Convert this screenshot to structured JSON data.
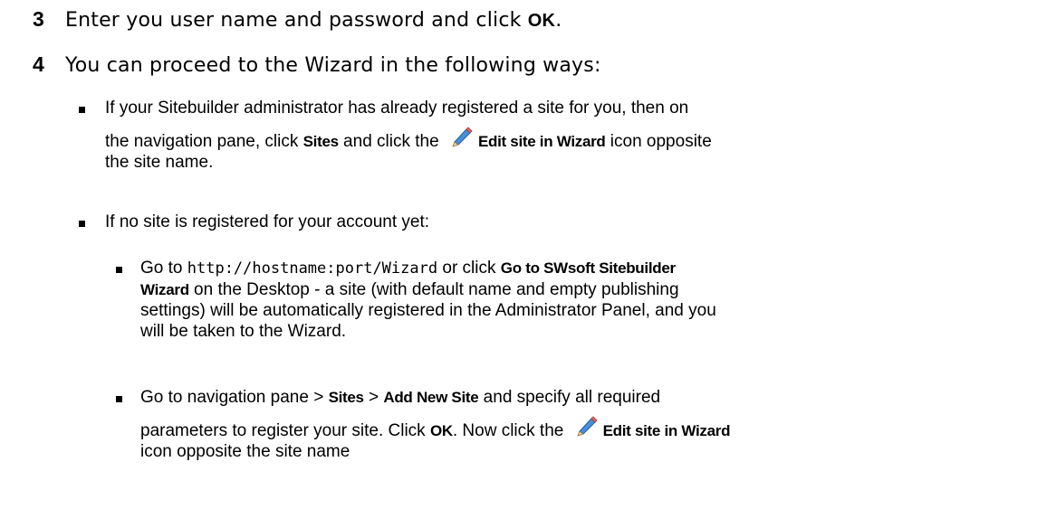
{
  "steps": [
    {
      "number": "3",
      "text_before": "Enter you user name and password and click ",
      "bold": "OK",
      "text_after": "."
    },
    {
      "number": "4",
      "text": "You can proceed to the Wizard in the following ways:"
    }
  ],
  "bullet1": {
    "line1": "If your Sitebuilder administrator has already registered a site for you, then on",
    "l2_a": "the navigation pane, click ",
    "l2_b_bold": "Sites",
    "l2_c": " and click the ",
    "l2_d_bold": "Edit site in Wizard",
    "l2_e": " icon opposite",
    "line3": "the site name."
  },
  "bullet2": {
    "text": "If no site is registered for your account yet:"
  },
  "sub1": {
    "l1_a": "Go to ",
    "l1_code": "http://hostname:port/Wizard",
    "l1_b": " or click ",
    "l1_bold": "Go to SWsoft Sitebuilder",
    "l2_bold": "Wizard",
    "l2_rest": " on the Desktop - a site (with default name and empty publishing",
    "line3": "settings) will be automatically registered in the Administrator Panel, and you",
    "line4": "will be taken to the Wizard."
  },
  "sub2": {
    "l1_a": "Go to navigation pane > ",
    "l1_bold1": "Sites",
    "l1_b": " > ",
    "l1_bold2": "Add New Site",
    "l1_c": " and specify all required",
    "l2_a": "parameters to register your site. Click ",
    "l2_bold": "OK",
    "l2_b": ". Now click the ",
    "l2_bold2": "Edit site in Wizard",
    "line3": "icon opposite the site name"
  },
  "icons": {
    "pencil": "pencil-edit-icon"
  }
}
